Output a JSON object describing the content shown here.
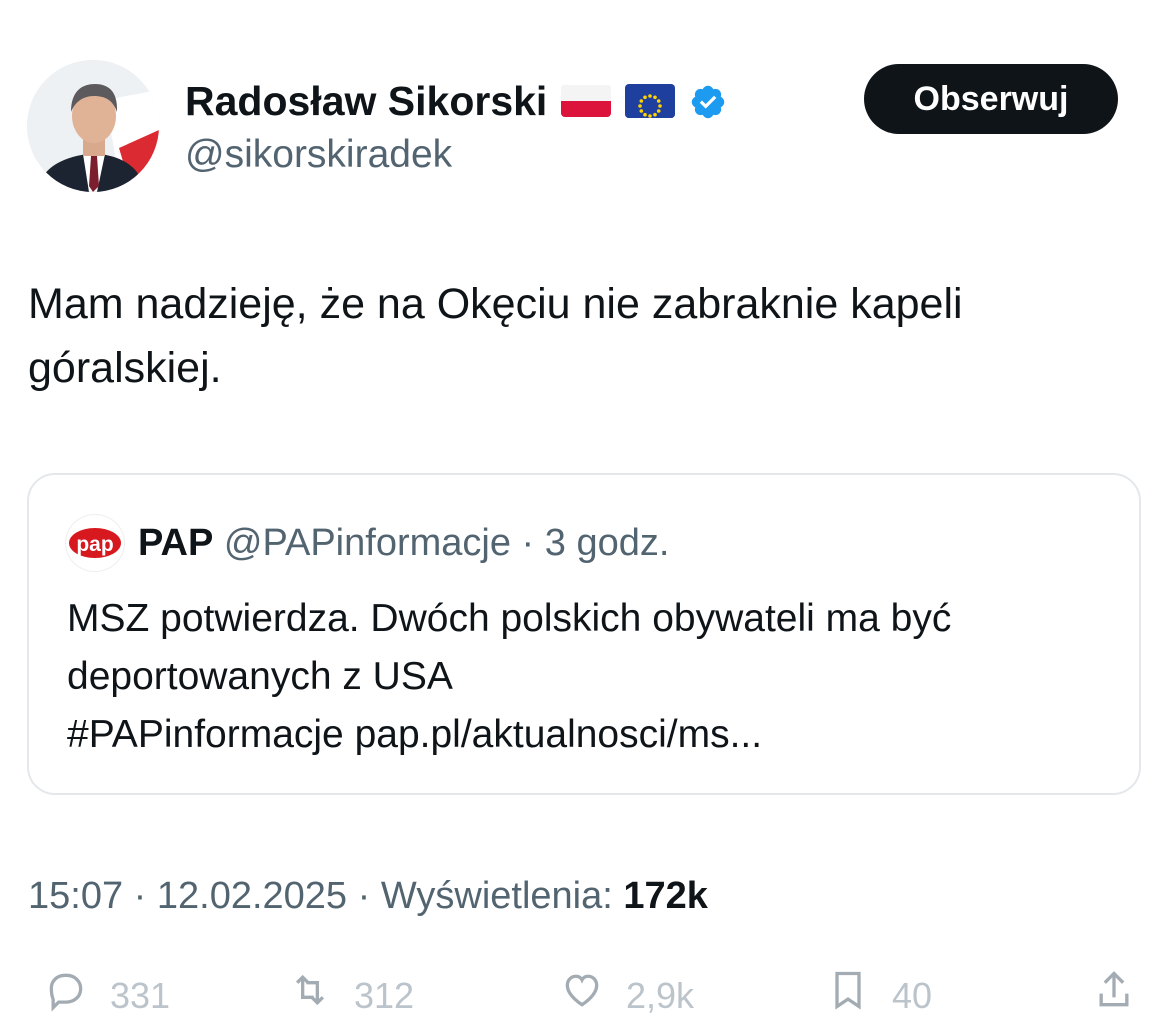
{
  "author": {
    "name": "Radosław Sikorski",
    "handle": "@sikorskiradek"
  },
  "follow_label": "Obserwuj",
  "tweet": {
    "line1": "Mam nadzieję, że na Okęciu nie zabraknie kapeli",
    "line2": "góralskiej."
  },
  "quote": {
    "logo_text": "pap",
    "name": "PAP",
    "handle": "@PAPinformacje",
    "time": "3 godz.",
    "line1": "MSZ potwierdza. Dwóch polskich obywateli ma być",
    "line2": "deportowanych z USA",
    "line3": "#PAPinformacje pap.pl/aktualnosci/ms..."
  },
  "meta": {
    "time": "15:07",
    "date": "12.02.2025",
    "views_label": "Wyświetlenia:",
    "views": "172k"
  },
  "actions": {
    "replies": "331",
    "retweets": "312",
    "likes": "2,9k",
    "bookmarks": "40"
  },
  "icons": {
    "avatar": "profile-photo",
    "verified": "verified-badge-icon",
    "flags": [
      "poland-flag-icon",
      "eu-flag-icon"
    ],
    "actions": [
      "reply-icon",
      "retweet-icon",
      "like-icon",
      "bookmark-icon",
      "share-icon"
    ]
  },
  "colors": {
    "accent": "#1d9bf0",
    "text": "#0f1419",
    "secondary": "#536471",
    "border": "#e4e8ec",
    "pap_red": "#d7191f"
  }
}
